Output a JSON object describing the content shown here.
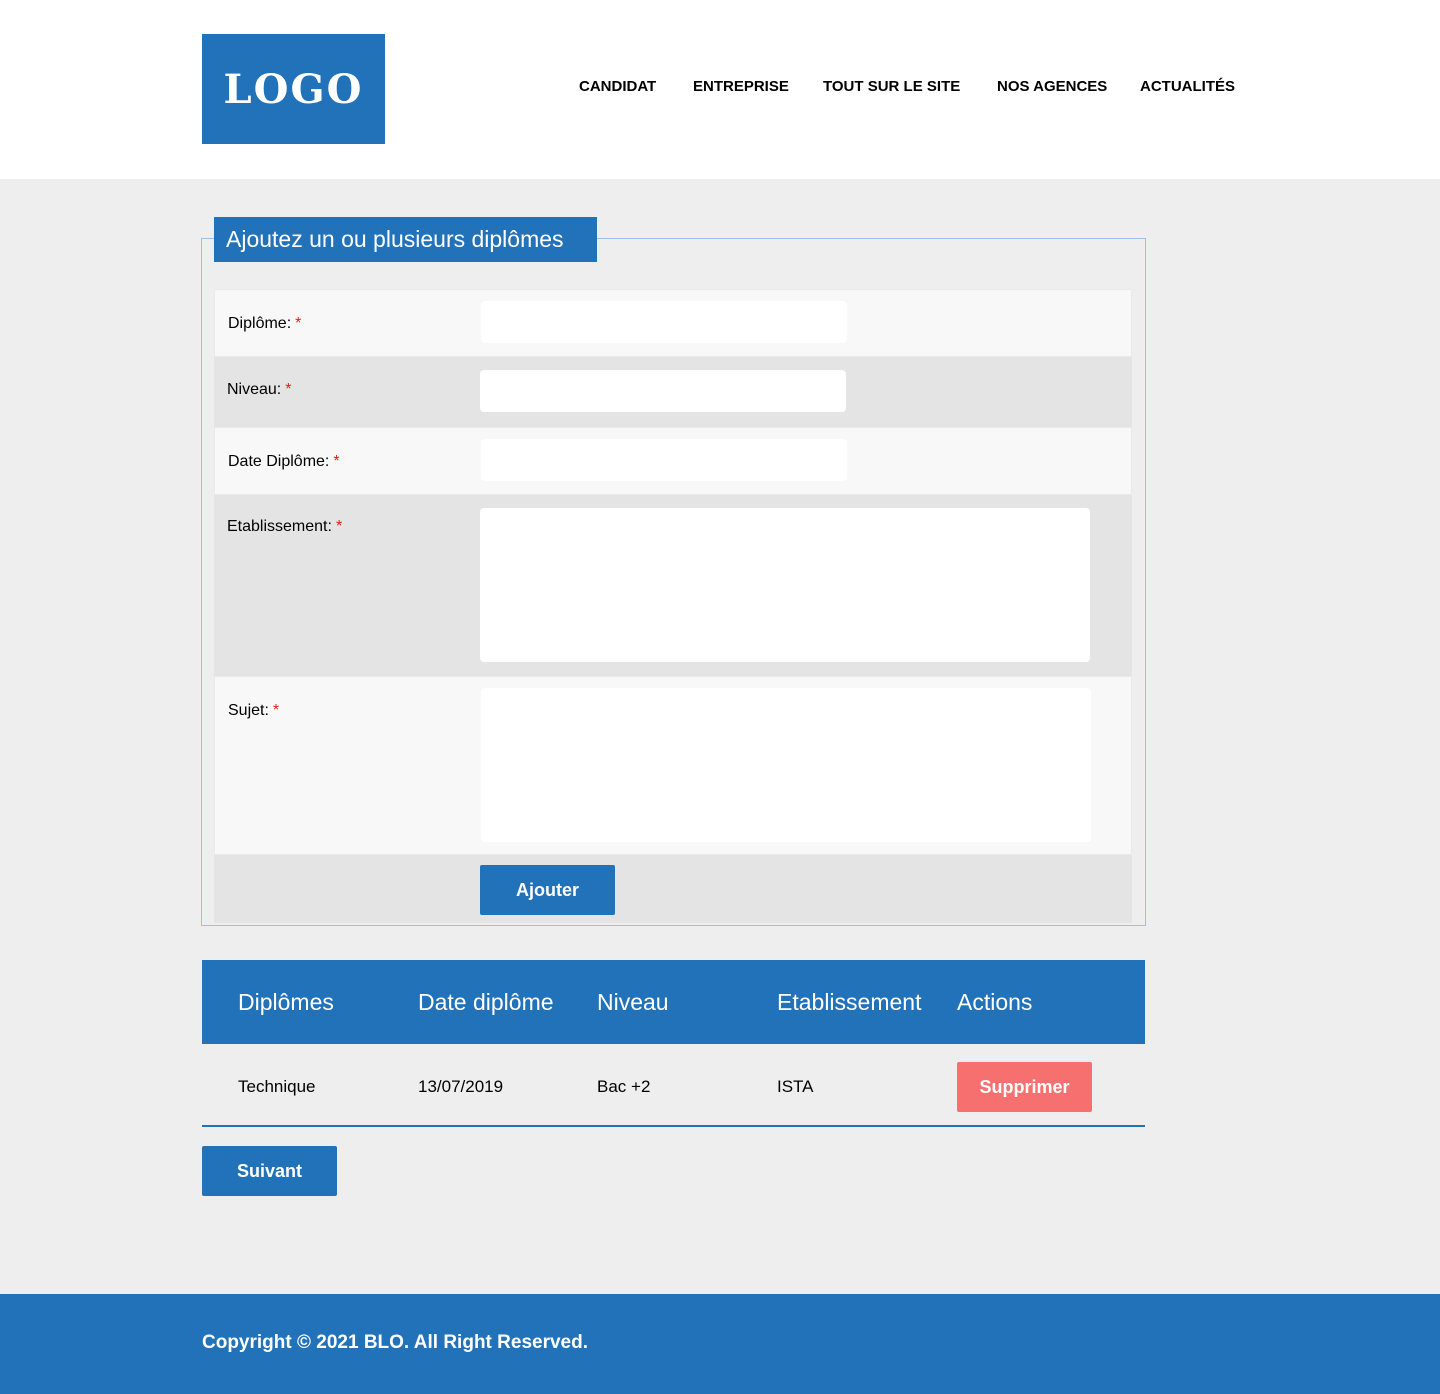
{
  "header": {
    "logo_text": "LOGO",
    "nav": [
      "CANDIDAT",
      "ENTREPRISE",
      "TOUT SUR LE SITE",
      "NOS AGENCES",
      "ACTUALITÉS"
    ]
  },
  "form": {
    "legend": "Ajoutez un ou plusieurs diplômes",
    "required_marker": "*",
    "fields": {
      "diplome": {
        "label": "Diplôme:",
        "value": ""
      },
      "niveau": {
        "label": "Niveau:",
        "value": ""
      },
      "date_diplome": {
        "label": "Date Diplôme:",
        "value": ""
      },
      "etablissement": {
        "label": "Etablissement:",
        "value": ""
      },
      "sujet": {
        "label": "Sujet:",
        "value": ""
      }
    },
    "submit_label": "Ajouter"
  },
  "table": {
    "headers": [
      "Diplômes",
      "Date diplôme",
      "Niveau",
      "Etablissement",
      "Actions"
    ],
    "rows": [
      {
        "diplome": "Technique",
        "date": "13/07/2019",
        "niveau": "Bac +2",
        "etablissement": "ISTA",
        "action_label": "Supprimer"
      }
    ]
  },
  "next_label": "Suivant",
  "footer": {
    "copyright": "Copyright © 2021 BLO. All Right Reserved."
  },
  "colors": {
    "primary": "#2272ba",
    "danger": "#f77070",
    "required": "#e0201c",
    "page_bg": "#eeeeee"
  }
}
